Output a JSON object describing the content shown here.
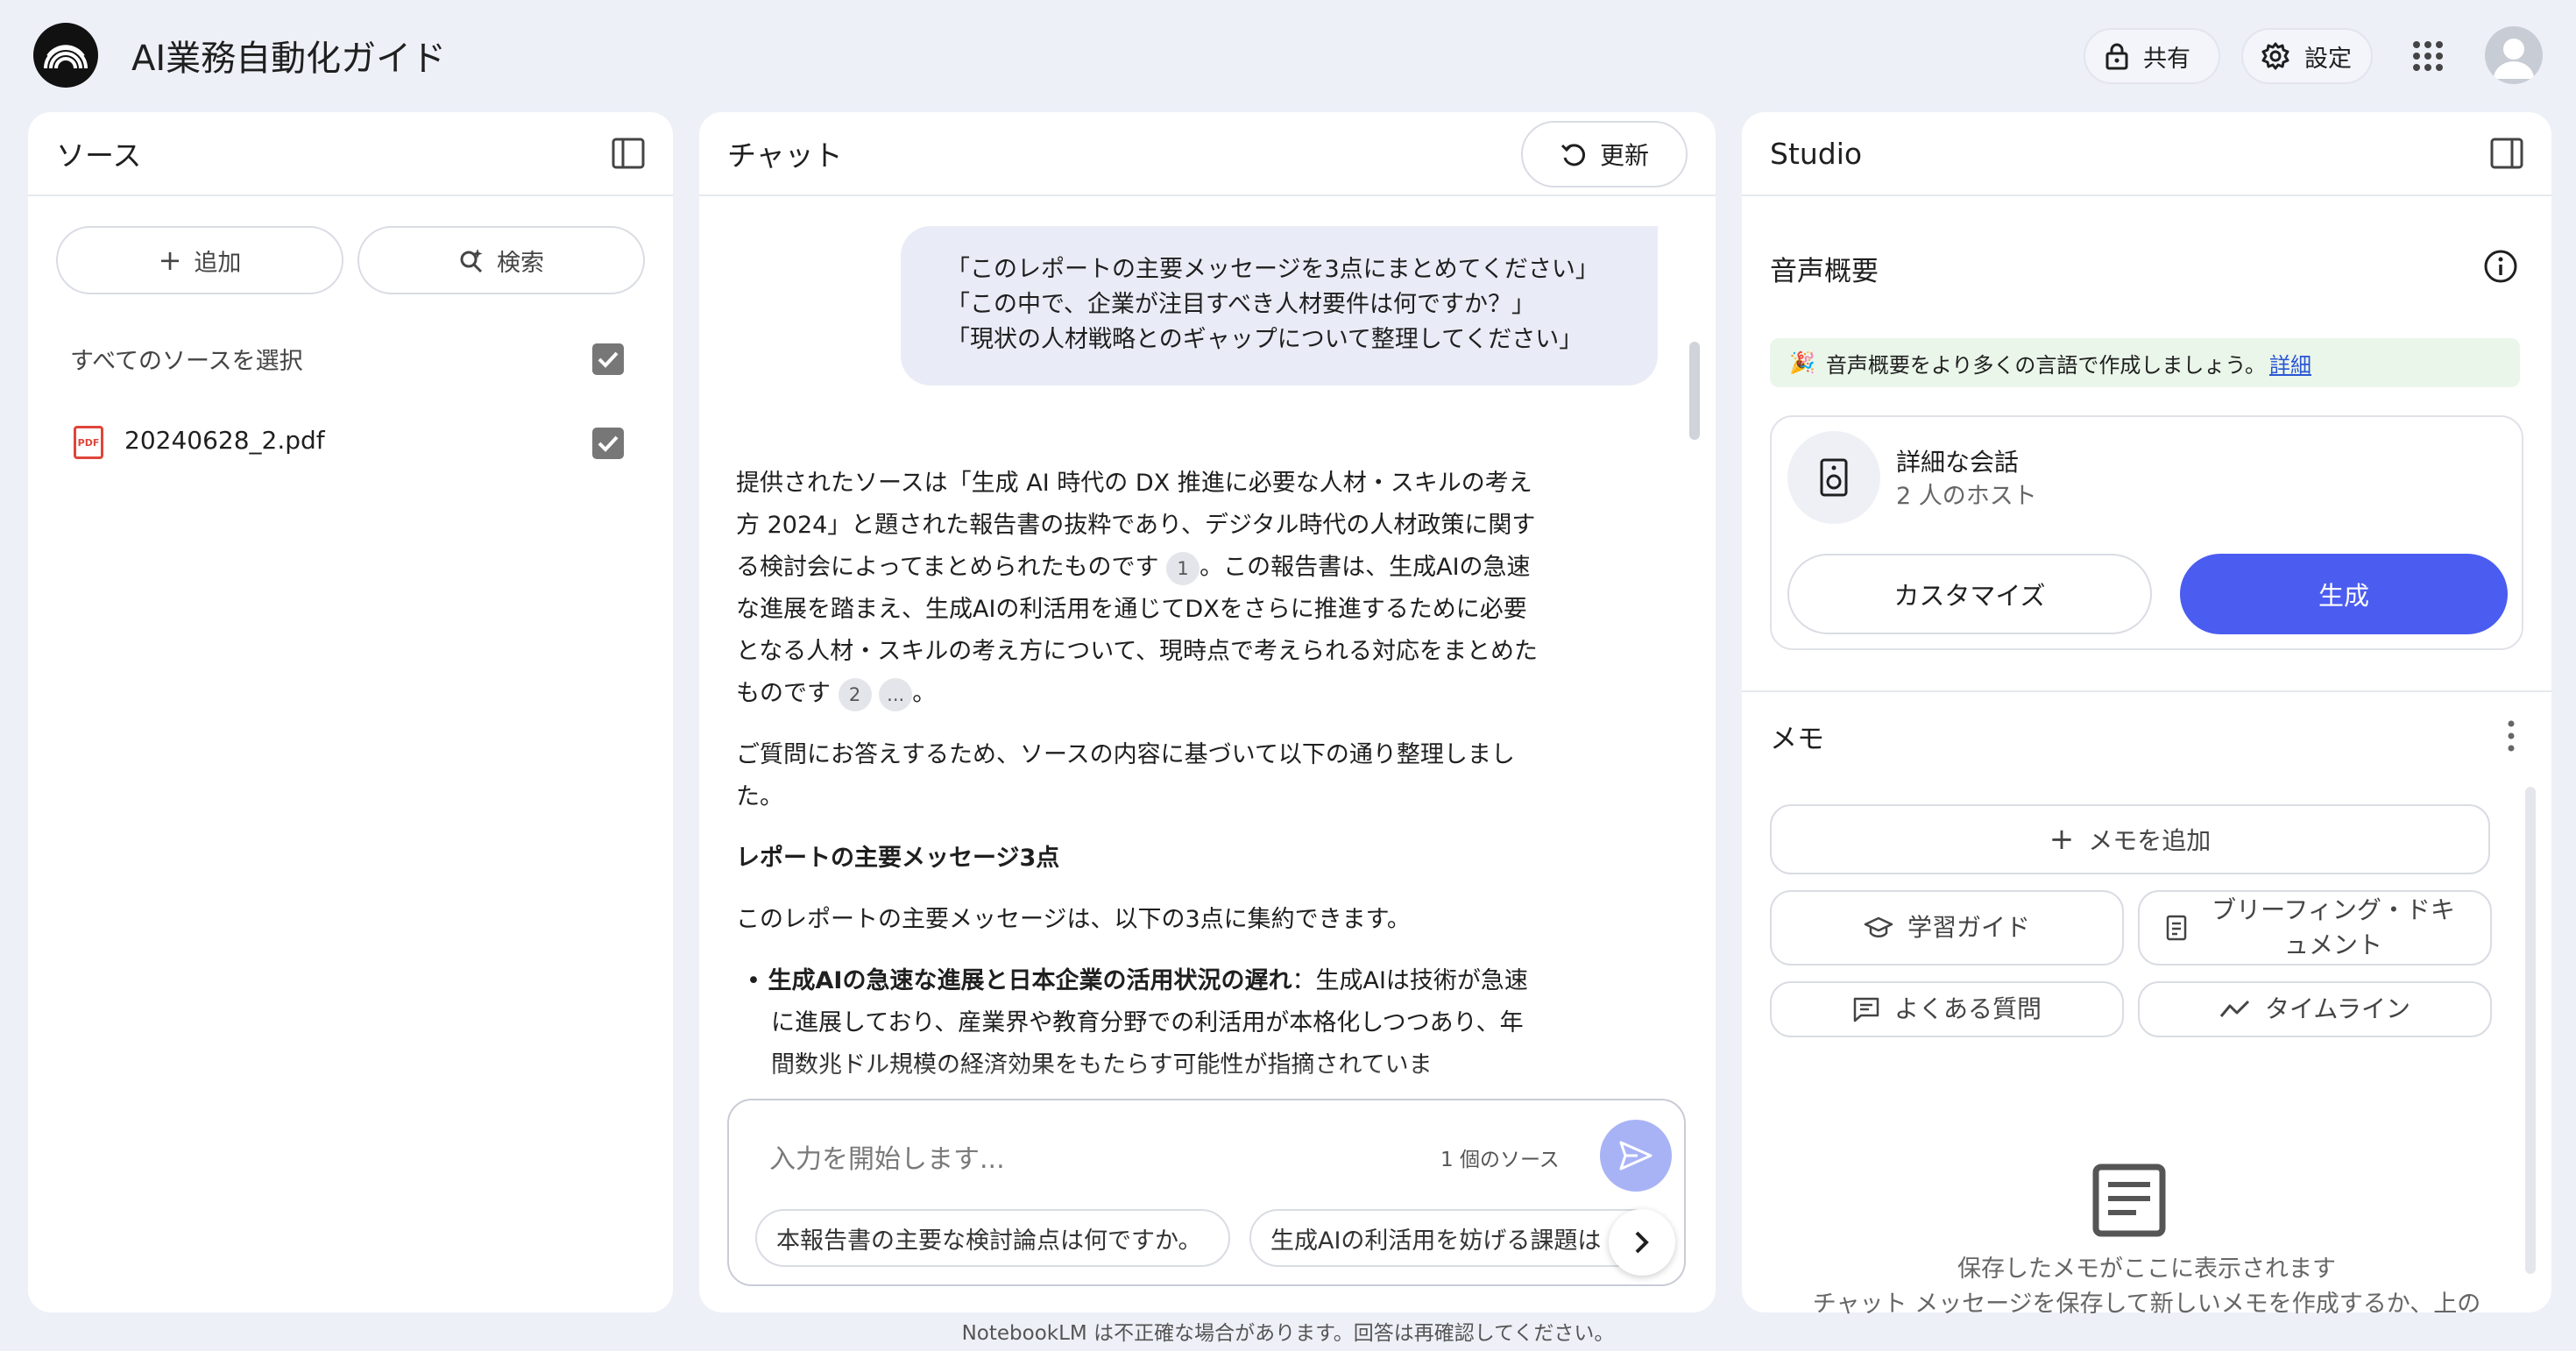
{
  "app": {
    "title": "AI業務自動化ガイド",
    "share_label": "共有",
    "settings_label": "設定",
    "footer_notice": "NotebookLM は不正確な場合があります。回答は再確認してください。"
  },
  "sources_panel": {
    "title": "ソース",
    "add_label": "追加",
    "search_label": "検索",
    "select_all_label": "すべてのソースを選択",
    "select_all_checked": true,
    "items": [
      {
        "name": "20240628_2.pdf",
        "icon": "pdf-icon",
        "checked": true
      }
    ]
  },
  "chat_panel": {
    "title": "チャット",
    "refresh_label": "更新",
    "user_message": {
      "line1": "「このレポートの主要メッセージを3点にまとめてください」",
      "line2": "「この中で、企業が注目すべき人材要件は何ですか？」",
      "line3": "「現状の人材戦略とのギャップについて整理してください」"
    },
    "answer": {
      "p1_a": "提供されたソースは「生成 AI 時代の DX 推進に必要な人材・スキルの考え方 2024」と題された報告書の抜粋であり、デジタル時代の人材政策に関する検討会によってまとめられたものです",
      "cite1": "1",
      "p1_b": "。この報告書は、生成AIの急速な進展を踏まえ、生成AIの利活用を通じてDXをさらに推進するために必要となる人材・スキルの考え方について、現時点で考えられる対応をまとめたものです",
      "cite2": "2",
      "cite_more": "...",
      "p1_end": "。",
      "p2": "ご質問にお答えするため、ソースの内容に基づいて以下の通り整理しました。",
      "heading": "レポートの主要メッセージ3点",
      "p3": "このレポートの主要メッセージは、以下の3点に集約できます。",
      "bullet1_bold": "生成AIの急速な進展と日本企業の活用状況の遅れ",
      "bullet1_text": "：生成AIは技術が急速に進展しており、産業界や教育分野での利活用が本格化しつつあり、年間数兆ドル規模の経済効果をもたらす可能性が指摘されていま"
    },
    "input": {
      "placeholder": "入力を開始します...",
      "source_count": "1 個のソース"
    },
    "suggestions": [
      "本報告書の主要な検討論点は何ですか。",
      "生成AIの利活用を妨げる課題は"
    ]
  },
  "studio_panel": {
    "title": "Studio",
    "audio_overview": {
      "title": "音声概要",
      "banner_emoji": "🎉",
      "banner_text": "音声概要をより多くの言語で作成しましょう。",
      "banner_link": "詳細",
      "card_title": "詳細な会話",
      "card_subtitle": "2 人のホスト",
      "customize_label": "カスタマイズ",
      "generate_label": "生成"
    },
    "memo": {
      "title": "メモ",
      "add_label": "メモを追加",
      "chips": [
        {
          "label": "学習ガイド",
          "icon": "graduation-cap-icon"
        },
        {
          "label": "ブリーフィング・ドキュメント",
          "icon": "document-icon"
        },
        {
          "label": "よくある質問",
          "icon": "faq-icon"
        },
        {
          "label": "タイムライン",
          "icon": "timeline-icon"
        }
      ],
      "empty_title": "保存したメモがここに表示されます",
      "empty_desc": "チャット メッセージを保存して新しいメモを作成するか、上の"
    }
  },
  "colors": {
    "background": "#eef0f8",
    "primary": "#4b5cf0",
    "send_button": "#a8b3f6",
    "banner_bg": "#eaf6ea",
    "pdf_red": "#e0453a"
  }
}
